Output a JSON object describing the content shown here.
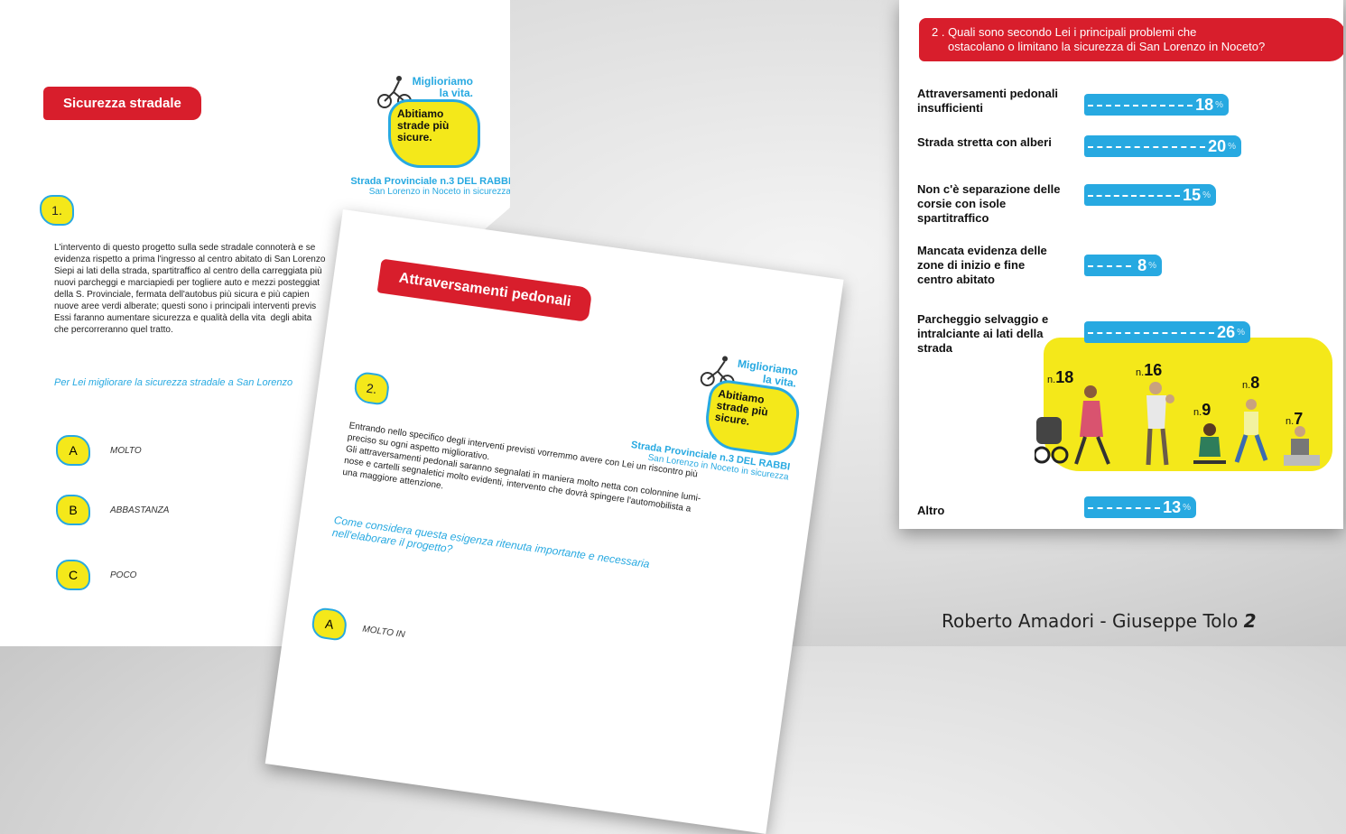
{
  "left_sheet": {
    "banner": "Sicurezza stradale",
    "logo": {
      "line1": "Miglioriamo",
      "line2": "la vita.",
      "line3": "Abitiamo",
      "line4": "strade più",
      "line5": "sicure."
    },
    "provincial": {
      "title": "Strada Provinciale n.3 DEL RABBI",
      "subtitle": "San Lorenzo in Noceto in sicurezza"
    },
    "number": "1.",
    "body": "L'intervento di questo progetto sulla sede stradale connoterà e se\nevidenza rispetto a prima l'ingresso al centro abitato di San Lorenzo\nSiepi ai lati della strada, spartitraffico al centro della carreggiata più\nnuovi parcheggi e marciapiedi per togliere auto e mezzi posteggiat\ndella S. Provinciale, fermata dell'autobus più sicura e più capien\nnuove aree verdi alberate; questi sono i principali interventi previs\nEssi faranno aumentare sicurezza e qualità della vita  degli abita\nche percorreranno quel tratto.",
    "question": "Per Lei migliorare la sicurezza stradale a San Lorenzo",
    "options": [
      {
        "letter": "A",
        "label": "MOLTO"
      },
      {
        "letter": "B",
        "label": "ABBASTANZA"
      },
      {
        "letter": "C",
        "label": "POCO"
      }
    ]
  },
  "middle_sheet": {
    "banner": "Attraversamenti pedonali",
    "logo": {
      "line1": "Miglioriamo",
      "line2": "la vita.",
      "line3": "Abitiamo",
      "line4": "strade più",
      "line5": "sicure."
    },
    "provincial": {
      "title": "Strada Provinciale n.3 DEL RABBI",
      "subtitle": "San Lorenzo in Noceto in sicurezza"
    },
    "number": "2.",
    "body": "Entrando nello specifico degli interventi previsti vorremmo avere con Lei un riscontro più\npreciso su ogni aspetto migliorativo.\nGli attraversamenti pedonali saranno segnalati in maniera molto netta con colonnine lumi-\nnose e cartelli segnaletici molto evidenti, intervento che dovrà spingere l'automobilista a\nuna maggiore attenzione.",
    "question_line1": "Come considera questa esigenza ritenuta importante e necessaria",
    "question_line2": "nell'elaborare il progetto?",
    "option": {
      "letter": "A",
      "label": "MOLTO IN"
    }
  },
  "right_sheet": {
    "banner_line1": "2 . Quali sono secondo Lei i principali problemi che",
    "banner_line2": "ostacolano o limitano la sicurezza di San Lorenzo in Noceto?",
    "pct_symbol": "%",
    "rows": [
      {
        "label": "Attraversamenti pedonali insufficienti",
        "value": "18"
      },
      {
        "label": "Strada stretta con alberi",
        "value": "20"
      },
      {
        "label": "Non c'è separazione delle corsie con isole spartitraffico",
        "value": "15"
      },
      {
        "label": "Mancata evidenza delle zone di inizio e fine centro abitato",
        "value": "8"
      },
      {
        "label": "Parcheggio selvaggio e intralciante ai lati della strada",
        "value": "26"
      },
      {
        "label": "Altro",
        "value": "13"
      }
    ],
    "counts": [
      {
        "prefix": "n.",
        "value": "18"
      },
      {
        "prefix": "n.",
        "value": "16"
      },
      {
        "prefix": "n.",
        "value": "9"
      },
      {
        "prefix": "n.",
        "value": "8"
      },
      {
        "prefix": "n.",
        "value": "7"
      }
    ]
  },
  "footer": {
    "authors": "Roberto Amadori - Giuseppe Tolo",
    "page": "2"
  }
}
